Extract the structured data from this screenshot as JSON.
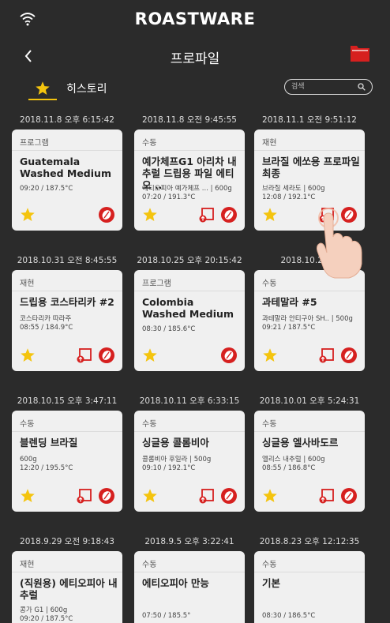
{
  "header": {
    "brand": "ROASTWARE",
    "title": "프로파일"
  },
  "history": {
    "label": "히스토리"
  },
  "search": {
    "placeholder": "검색"
  },
  "colors": {
    "background": "#2b2b2b",
    "accent_star": "#f4c40e",
    "accent_red": "#d6201f",
    "card_bg": "#f0f0f0"
  },
  "icons": {
    "status": "wifi-icon",
    "back": "back-arrow-icon",
    "folder": "folder-icon",
    "history": "star-icon",
    "search": "search-icon",
    "favorite": "star-icon",
    "export": "export-icon",
    "bean": "coffee-bean-icon",
    "gesture": "tap-hand-icon"
  },
  "cards": [
    {
      "date": "2018.11.8  오후 6:15:42",
      "type": "프로그램",
      "title": "Guatemala Washed Medium",
      "detail1": "",
      "detail2": "09:20 / 187.5°C",
      "export": false
    },
    {
      "date": "2018.11.8  오전 9:45:55",
      "type": "수동",
      "title": "예가체프G1 아리차 내추럴 드립용 파일 에티오 ..",
      "detail1": "에티오피아 예가체프 ... | 600g",
      "detail2": "07:20 / 191.3°C",
      "export": true
    },
    {
      "date": "2018.11.1  오전 9:51:12",
      "type": "재현",
      "title": "브라질 에쏘용 프로파일 최종",
      "detail1": "브라질 세라도 | 600g",
      "detail2": "12:08 / 192.1°C",
      "export": true
    },
    {
      "date": "2018.10.31  오전 8:45:55",
      "type": "재현",
      "title": "드립용 코스타리카 #2",
      "detail1": "코스타리카 따라주",
      "detail2": "08:55 / 184.9°C",
      "export": true
    },
    {
      "date": "2018.10.25  오후 20:15:42",
      "type": "프로그램",
      "title": "Colombia Washed Medium",
      "detail1": "",
      "detail2": "08:30 / 185.6°C",
      "export": false
    },
    {
      "date": "2018.10.24  오",
      "type": "수동",
      "title": "과테말라 #5",
      "detail1": "과테말라 안티구아 SH.. | 500g",
      "detail2": "09:21 / 187.5°C",
      "export": true
    },
    {
      "date": "2018.10.15  오후 3:47:11",
      "type": "수동",
      "title": "블렌딩 브라질",
      "detail1": "600g",
      "detail2": "12:20 / 195.5°C",
      "export": true
    },
    {
      "date": "2018.10.11  오후 6:33:15",
      "type": "수동",
      "title": "싱글용 콜롬비아",
      "detail1": "콜롬비아 후일라 | 500g",
      "detail2": "09:10 / 192.1°C",
      "export": true
    },
    {
      "date": "2018.10.01  오후 5:24:31",
      "type": "수동",
      "title": "싱글용 엘사바도르",
      "detail1": "엘리스 내추럴 | 600g",
      "detail2": "08:55 / 186.8°C",
      "export": true
    },
    {
      "date": "2018.9.29  오전 9:18:43",
      "type": "재현",
      "title": "(직원용) 에티오피아 내추럴",
      "detail1": "콩가 G1 | 600g",
      "detail2": "09:20 / 187.5°C",
      "export": false
    },
    {
      "date": "2018.9.5  오후 3:22:41",
      "type": "수동",
      "title": "에티오피아 만능",
      "detail1": "",
      "detail2": "07:50 / 185.5°",
      "export": false
    },
    {
      "date": "2018.8.23  오후 12:12:35",
      "type": "수동",
      "title": "기본",
      "detail1": "",
      "detail2": "08:30 / 186.5°C",
      "export": false
    }
  ]
}
